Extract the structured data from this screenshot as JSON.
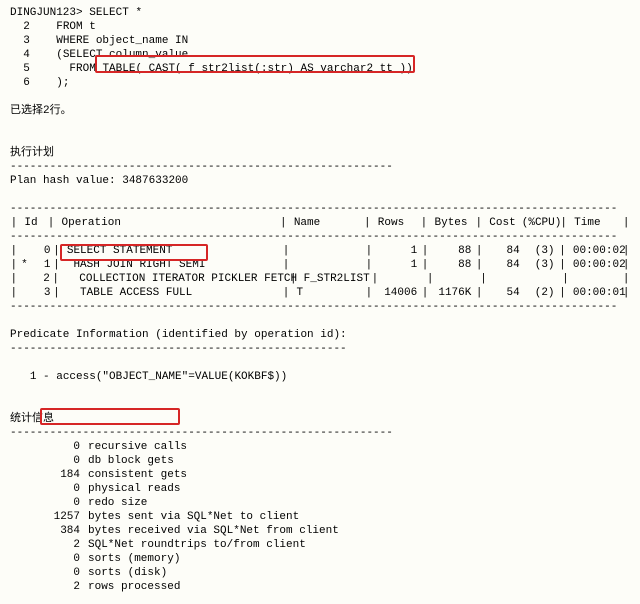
{
  "sql": {
    "prompt": "DINGJUN123>",
    "l1": "SELECT *",
    "l2": "FROM t",
    "l3": "WHERE object_name IN",
    "l4": "(SELECT column_value",
    "l5a": "FROM",
    "l5b": "TABLE( CAST( f_str2list(:str) AS varchar2_tt ))",
    "l6": ");",
    "ln2": "2",
    "ln3": "3",
    "ln4": "4",
    "ln5": "5",
    "ln6": "6"
  },
  "selected_rows_msg": "已选择2行。",
  "plan_title": "执行计划",
  "plan_hash_label": "Plan hash value:",
  "plan_hash_value": "3487633200",
  "plan_headers": {
    "id": "Id",
    "op": "Operation",
    "name": "Name",
    "rows": "Rows",
    "bytes": "Bytes",
    "cost": "Cost",
    "cpu": "(%CPU)",
    "time": "Time"
  },
  "plan": [
    {
      "star": " ",
      "id": "0",
      "op": "SELECT STATEMENT",
      "name": "",
      "rows": "1",
      "bytes": "88",
      "cost": "84",
      "cpu": "(3)",
      "time": "00:00:02"
    },
    {
      "star": "*",
      "id": "1",
      "op": " HASH JOIN RIGHT SEMI",
      "name": "",
      "rows": "1",
      "bytes": "88",
      "cost": "84",
      "cpu": "(3)",
      "time": "00:00:02"
    },
    {
      "star": " ",
      "id": "2",
      "op": "  COLLECTION ITERATOR PICKLER FETCH",
      "name": "F_STR2LIST",
      "rows": "",
      "bytes": "",
      "cost": "",
      "cpu": "",
      "time": ""
    },
    {
      "star": " ",
      "id": "3",
      "op": "  TABLE ACCESS FULL",
      "name": "T",
      "rows": "14006",
      "bytes": "1176K",
      "cost": "54",
      "cpu": "(2)",
      "time": "00:00:01"
    }
  ],
  "predicate_title": "Predicate Information (identified by operation id):",
  "predicate_line": "1 - access(\"OBJECT_NAME\"=VALUE(KOKBF$))",
  "stats_title": "统计信息",
  "stats": [
    {
      "v": "0",
      "l": "recursive calls"
    },
    {
      "v": "0",
      "l": "db block gets"
    },
    {
      "v": "184",
      "l": "consistent gets"
    },
    {
      "v": "0",
      "l": "physical reads"
    },
    {
      "v": "0",
      "l": "redo size"
    },
    {
      "v": "1257",
      "l": "bytes sent via SQL*Net to client"
    },
    {
      "v": "384",
      "l": "bytes received via SQL*Net from client"
    },
    {
      "v": "2",
      "l": "SQL*Net roundtrips to/from client"
    },
    {
      "v": "0",
      "l": "sorts (memory)"
    },
    {
      "v": "0",
      "l": "sorts (disk)"
    },
    {
      "v": "2",
      "l": "rows processed"
    }
  ]
}
